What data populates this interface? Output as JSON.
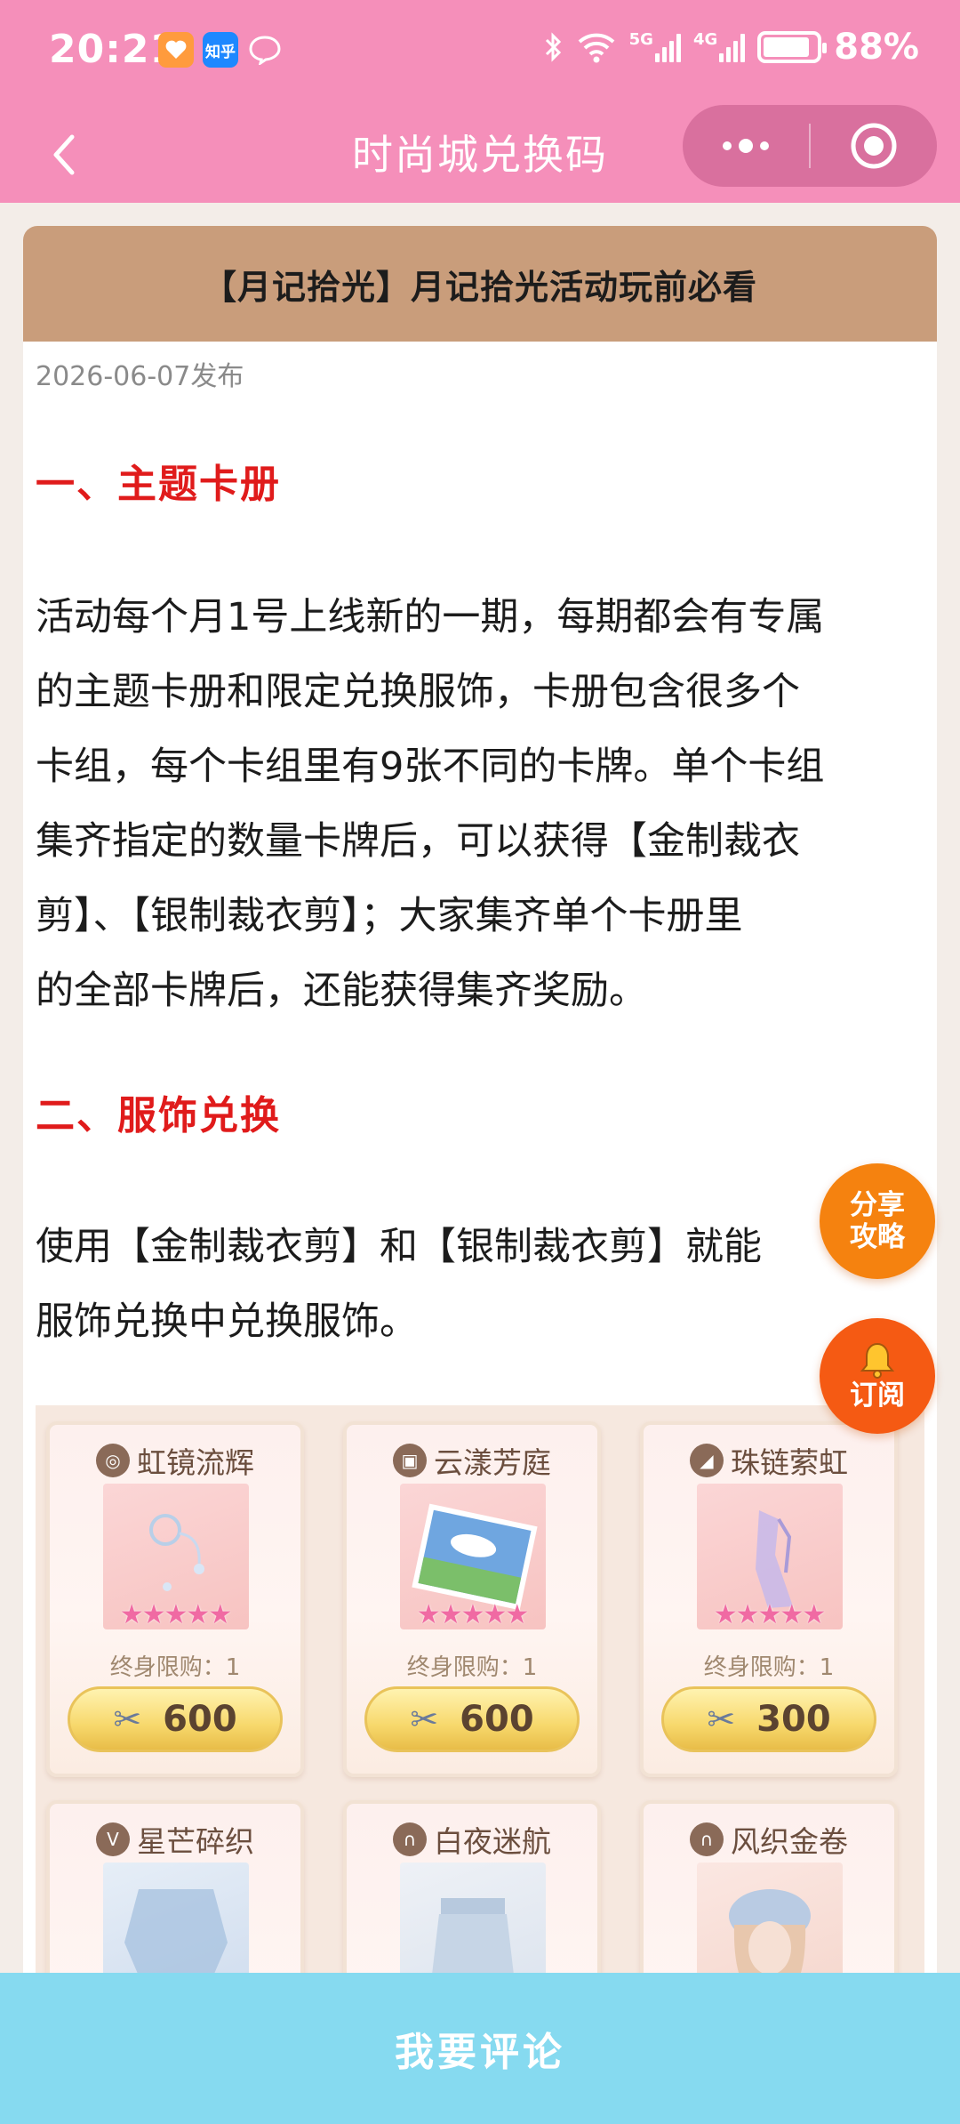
{
  "status_bar": {
    "time": "20:21",
    "app_icons": [
      "heart-app-icon",
      "zhihu-app-icon",
      "chat-app-icon"
    ],
    "zhihu_label": "知乎",
    "network_5g": "5G",
    "network_4g": "4G",
    "battery": "88%",
    "battery_level": 0.88
  },
  "nav": {
    "title": "时尚城兑换码"
  },
  "article": {
    "header": "【月记拾光】月记拾光活动玩前必看",
    "date": "2026-06-07发布",
    "section1_title": "一、主题卡册",
    "section1_lines": [
      "活动每个月1号上线新的一期，每期都会有专属",
      "的主题卡册和限定兑换服饰，卡册包含很多个",
      "卡组，每个卡组里有9张不同的卡牌。单个卡组",
      "集齐指定的数量卡牌后，可以获得【金制裁衣",
      "剪】、【银制裁衣剪】；大家集齐单个卡册里",
      "的全部卡牌后，还能获得集齐奖励。"
    ],
    "section2_title": "二、服饰兑换",
    "section2_lines": [
      "使用【金制裁衣剪】和【银制裁衣剪】就能",
      "服饰兑换中兑换服饰。"
    ]
  },
  "shop_items": [
    {
      "name": "虹镜流辉",
      "stars": 5,
      "limit": "终身限购：1",
      "price": "600"
    },
    {
      "name": "云漾芳庭",
      "stars": 5,
      "limit": "终身限购：1",
      "price": "600"
    },
    {
      "name": "珠链萦虹",
      "stars": 5,
      "limit": "终身限购：1",
      "price": "300"
    },
    {
      "name": "星芒碎织"
    },
    {
      "name": "白夜迷航"
    },
    {
      "name": "风织金卷"
    }
  ],
  "fab": {
    "share_line1": "分享",
    "share_line2": "攻略",
    "subscribe": "订阅"
  },
  "bottom": {
    "comment_label": "我要评论"
  },
  "colors": {
    "nav_pink": "#f58fba",
    "header_tan": "#c99d7b",
    "heading_red": "#e01b1b",
    "fab_orange": "#f5820f",
    "bottom_cyan": "#86daf0"
  }
}
